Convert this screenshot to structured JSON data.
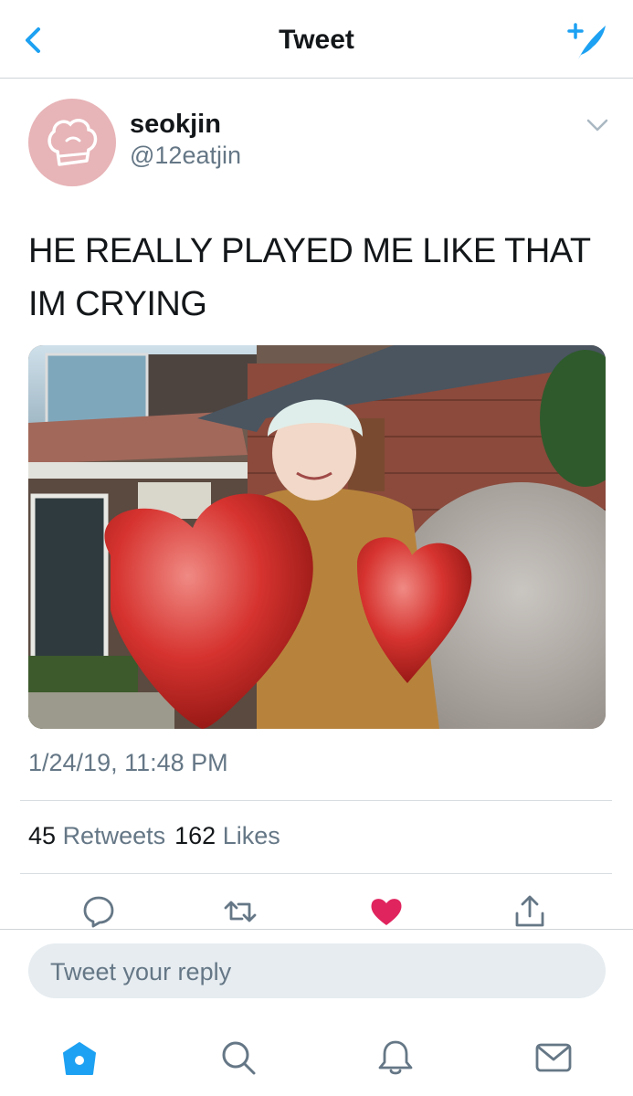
{
  "nav": {
    "title": "Tweet",
    "back_icon": "chevron-left-icon",
    "compose_icon": "compose-feather-icon"
  },
  "tweet": {
    "display_name": "seokjin",
    "handle": "@12eatjin",
    "text_line1": "HE REALLY PLAYED ME LIKE THAT",
    "text_line2": "IM CRYING",
    "timestamp": "1/24/19, 11:48 PM",
    "retweets_count": "45",
    "retweets_label": "Retweets",
    "likes_count": "162",
    "likes_label": "Likes",
    "liked": true
  },
  "actions": [
    "reply-icon",
    "retweet-icon",
    "like-heart-icon",
    "share-icon"
  ],
  "reply": {
    "placeholder": "Tweet your reply"
  },
  "tabs": [
    "home-icon",
    "search-icon",
    "notifications-bell-icon",
    "messages-envelope-icon"
  ],
  "colors": {
    "accent": "#1da1f2",
    "like": "#e0245e",
    "secondary_text": "#657786",
    "avatar_bg": "#e7b4b7"
  }
}
